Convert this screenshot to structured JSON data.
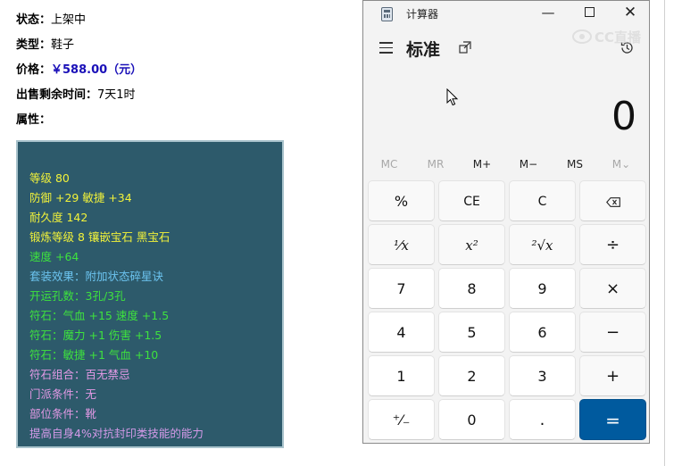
{
  "item": {
    "status_label": "状态：",
    "status_value": "上架中",
    "type_label": "类型：",
    "type_value": "鞋子",
    "price_label": "价格：",
    "price_value": "￥588.00（元）",
    "time_label": "出售剩余时间：",
    "time_value": "7天1时",
    "attr_label": "属性：",
    "stats": [
      {
        "text": "等级 80",
        "color": "#f2f23a"
      },
      {
        "text": "防御 +29 敏捷 +34",
        "color": "#f2f23a"
      },
      {
        "text": "耐久度 142",
        "color": "#f2f23a"
      },
      {
        "text": "锻炼等级 8 镶嵌宝石 黑宝石",
        "color": "#f2f23a"
      },
      {
        "text": "速度 +64",
        "color": "#3ee23e"
      },
      {
        "text": "套装效果：附加状态碎星诀",
        "color": "#6cc4f0"
      },
      {
        "text": "开运孔数：3孔/3孔",
        "color": "#3ee23e"
      },
      {
        "text": "符石：气血 +15 速度 +1.5",
        "color": "#3ee23e"
      },
      {
        "text": "符石：魔力 +1 伤害 +1.5",
        "color": "#3ee23e"
      },
      {
        "text": "符石：敏捷 +1 气血 +10",
        "color": "#3ee23e"
      },
      {
        "text": "符石组合：百无禁忌",
        "color": "#e49ae6"
      },
      {
        "text": "门派条件：无",
        "color": "#e49ae6"
      },
      {
        "text": "部位条件：靴",
        "color": "#e49ae6"
      },
      {
        "text": "提高自身4%对抗封印类技能的能力",
        "color": "#d49ae8"
      }
    ]
  },
  "calculator": {
    "title": "计算器",
    "mode": "标准",
    "display": "0",
    "window_buttons": {
      "minimize": "—",
      "close": "✕"
    },
    "memory": [
      "MC",
      "MR",
      "M+",
      "M−",
      "MS",
      "M⌄"
    ],
    "keys": {
      "percent": "%",
      "ce": "CE",
      "c": "C",
      "backspace": "⌫",
      "reciprocal": "¹⁄x",
      "square": "x²",
      "sqrt": "²√x",
      "divide": "÷",
      "n7": "7",
      "n8": "8",
      "n9": "9",
      "multiply": "×",
      "n4": "4",
      "n5": "5",
      "n6": "6",
      "minus": "−",
      "n1": "1",
      "n2": "2",
      "n3": "3",
      "plus": "+",
      "negate": "⁺⁄₋",
      "n0": "0",
      "decimal": ".",
      "equals": "="
    },
    "accent_color": "#005a9e"
  },
  "watermark": {
    "text": "CC直播"
  }
}
